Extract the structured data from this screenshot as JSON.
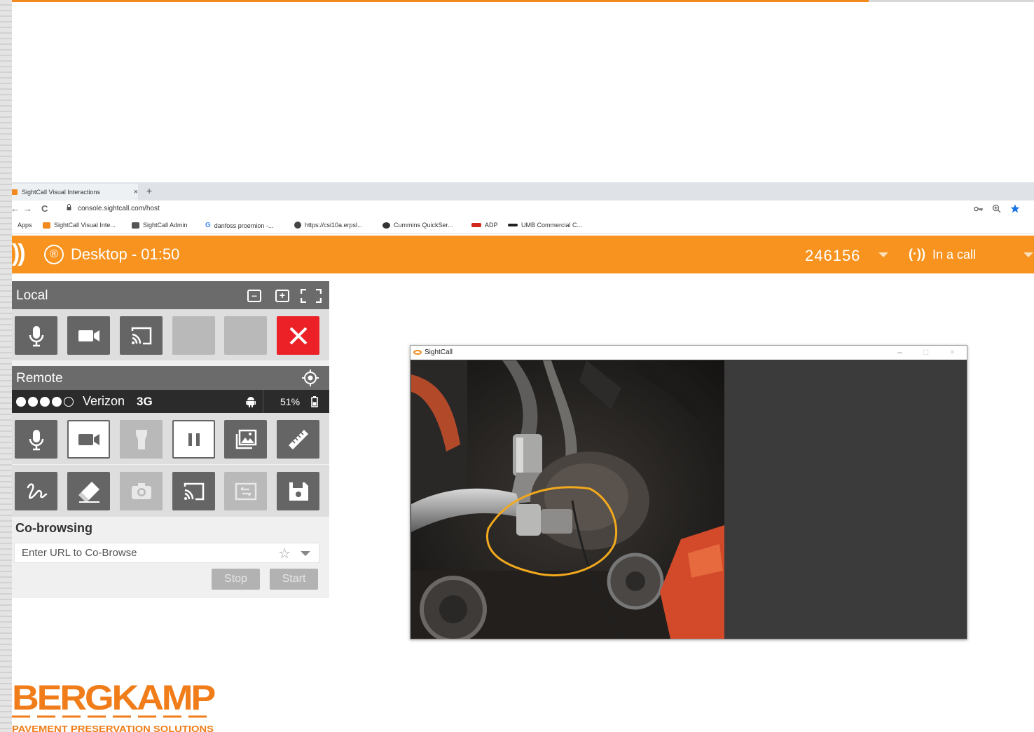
{
  "browser": {
    "tab_title": "SightCall Visual Interactions",
    "tab_close": "×",
    "new_tab": "+",
    "back": "←",
    "forward": "→",
    "reload": "C",
    "url": "console.sightcall.com/host",
    "bookmarks": [
      {
        "label": "Apps",
        "icon": "apps-icon"
      },
      {
        "label": "SightCall Visual Inte...",
        "icon": "sightcall-icon"
      },
      {
        "label": "SightCall Admin",
        "icon": "sightcall-admin-icon"
      },
      {
        "label": "danfoss proemion -...",
        "icon": "google-icon"
      },
      {
        "label": "https://csi10a.erpsl...",
        "icon": "globe-icon"
      },
      {
        "label": "Cummins QuickSer...",
        "icon": "cummins-icon"
      },
      {
        "label": "ADP",
        "icon": "adp-icon"
      },
      {
        "label": "UMB Commercial C...",
        "icon": "umb-icon"
      }
    ]
  },
  "header": {
    "title": "Desktop - 01:50",
    "session_id": "246156",
    "status": "In a call",
    "logo_glyph": "))",
    "badge_glyph": "®",
    "call_glyph": "(·))"
  },
  "local": {
    "title": "Local",
    "buttons": [
      "microphone-icon",
      "video-camera-icon",
      "screen-cast-icon",
      "blank",
      "blank",
      "close-icon"
    ]
  },
  "remote": {
    "title": "Remote",
    "carrier": "Verizon",
    "network": "3G",
    "battery": "51%",
    "signal_bars_filled": 4,
    "signal_bars_total": 5,
    "row1": [
      "microphone-icon",
      "video-camera-icon",
      "flashlight-icon",
      "pause-icon",
      "gallery-icon",
      "ruler-icon"
    ],
    "row2": [
      "draw-icon",
      "eraser-icon",
      "camera-icon",
      "screen-cast-icon",
      "swap-icon",
      "save-icon"
    ]
  },
  "cobrowsing": {
    "title": "Co-browsing",
    "placeholder": "Enter URL to Co-Browse",
    "stop": "Stop",
    "start": "Start"
  },
  "video_window": {
    "title": "SightCall",
    "controls": [
      "–",
      "□",
      "×"
    ]
  },
  "logo": {
    "name": "BERGKAMP",
    "tagline": "PAVEMENT PRESERVATION SOLUTIONS",
    "color": "#f07d1a"
  },
  "colors": {
    "accent": "#f7931e",
    "danger": "#ec2127",
    "panel_dark": "#6b6b6b",
    "button": "#656565"
  }
}
